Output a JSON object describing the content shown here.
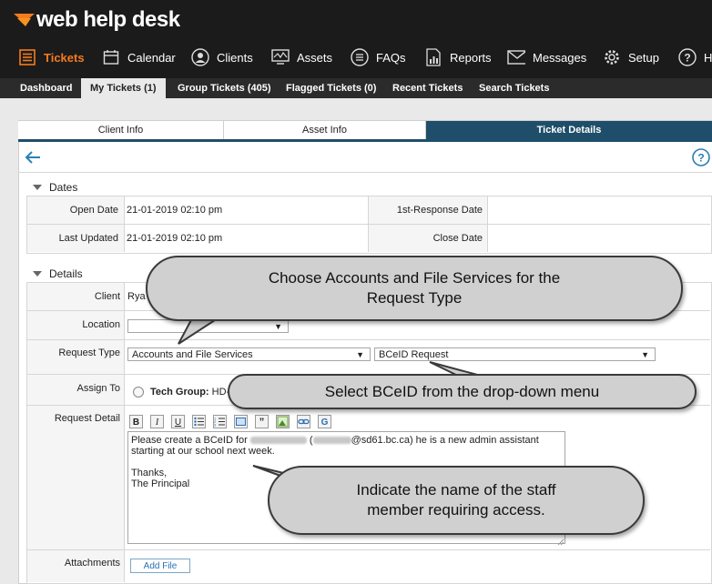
{
  "brand": {
    "logo_text": "web help desk",
    "accent": "#f47b20"
  },
  "nav": {
    "items": [
      {
        "label": "Tickets",
        "icon": "list-icon"
      },
      {
        "label": "Calendar",
        "icon": "calendar-icon"
      },
      {
        "label": "Clients",
        "icon": "person-icon"
      },
      {
        "label": "Assets",
        "icon": "monitor-icon"
      },
      {
        "label": "FAQs",
        "icon": "faq-list-icon"
      },
      {
        "label": "Reports",
        "icon": "report-icon"
      },
      {
        "label": "Messages",
        "icon": "envelope-icon"
      },
      {
        "label": "Setup",
        "icon": "gear-icon"
      },
      {
        "label": "H",
        "icon": "help-icon"
      }
    ]
  },
  "subnav": {
    "items": [
      {
        "label": "Dashboard"
      },
      {
        "label": "My Tickets (1)"
      },
      {
        "label": "Group Tickets (405)"
      },
      {
        "label": "Flagged Tickets (0)"
      },
      {
        "label": "Recent Tickets"
      },
      {
        "label": "Search Tickets"
      }
    ]
  },
  "tabs": [
    {
      "label": "Client Info"
    },
    {
      "label": "Asset Info"
    },
    {
      "label": "Ticket Details"
    }
  ],
  "dates": {
    "title": "Dates",
    "open_label": "Open Date",
    "open_value": "21-01-2019 02:10 pm",
    "updated_label": "Last Updated",
    "updated_value": "21-01-2019 02:10 pm",
    "first_response_label": "1st-Response Date",
    "close_label": "Close Date"
  },
  "details": {
    "title": "Details",
    "client_label": "Client",
    "client_value": "Rya",
    "location_label": "Location",
    "request_type_label": "Request Type",
    "request_type_value": "Accounts and File Services",
    "request_subtype_value": "BCeID Request",
    "assign_label": "Assign To",
    "assign_value_bold": "Tech Group:",
    "assign_value": "HD-",
    "request_detail_label": "Request Detail",
    "detail_line1_a": "Please create a BCeID for",
    "detail_line1_b": "(",
    "detail_line1_c": "@sd61.bc.ca) he is a new admin assistant",
    "detail_line2": "starting at our school next week.",
    "detail_line4": "Thanks,",
    "detail_line5": "The Principal",
    "attachments_label": "Attachments",
    "add_file_label": "Add File"
  },
  "toolbar": [
    "B",
    "I",
    "U"
  ],
  "callouts": {
    "c1": "Choose Accounts and File Services for the Request Type",
    "c2": "Select BCeID from the drop-down menu",
    "c3": "Indicate the name of the staff member requiring access."
  }
}
